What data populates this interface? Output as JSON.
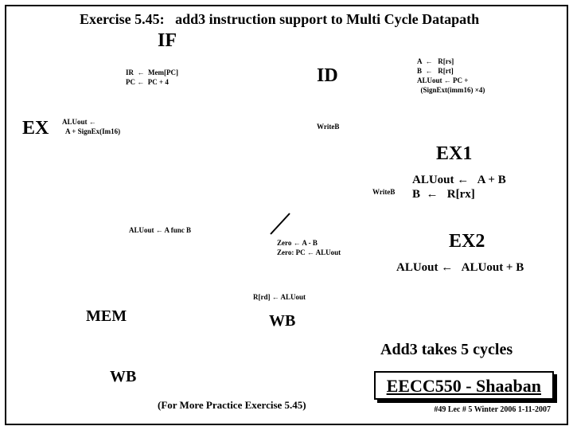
{
  "title_line1": "Exercise 5.45:   add3 instruction support to Multi Cycle Datapath",
  "stages": {
    "IF": "IF",
    "ID": "ID",
    "EX": "EX",
    "EX1": "EX1",
    "EX2": "EX2",
    "MEM": "MEM",
    "WB_top": "WB",
    "WB_bottom": "WB"
  },
  "if_block": {
    "l1": "IR  ←  Mem[PC]",
    "l2": "PC ←  PC + 4"
  },
  "id_block": {
    "l1": "A  ←   R[rs]",
    "l2": "B  ←   R[rt]",
    "l3": "ALUout ← PC +",
    "l4": "  (SignExt(imm16) ×4)"
  },
  "ex_block": {
    "l1": "ALUout ←",
    "l2": "  A + SignEx(Im16)"
  },
  "writeB": "WriteB",
  "ex1_block": {
    "l1": "ALUout ←   A + B",
    "l2": "B  ←   R[rx]"
  },
  "a_func_b": "ALUout ← A func B",
  "zero_block": {
    "l1": "Zero ← A - B",
    "l2": "Zero: PC ← ALUout"
  },
  "ex2_result": "ALUout ←   ALUout + B",
  "rd_aluout": "R[rd] ← ALUout",
  "cycles_text": "Add3 takes 5 cycles",
  "for_more": "(For More Practice Exercise 5.45)",
  "footer": {
    "course": "EECC550 - Shaaban",
    "sub": "#49   Lec # 5  Winter 2006  1-11-2007"
  }
}
